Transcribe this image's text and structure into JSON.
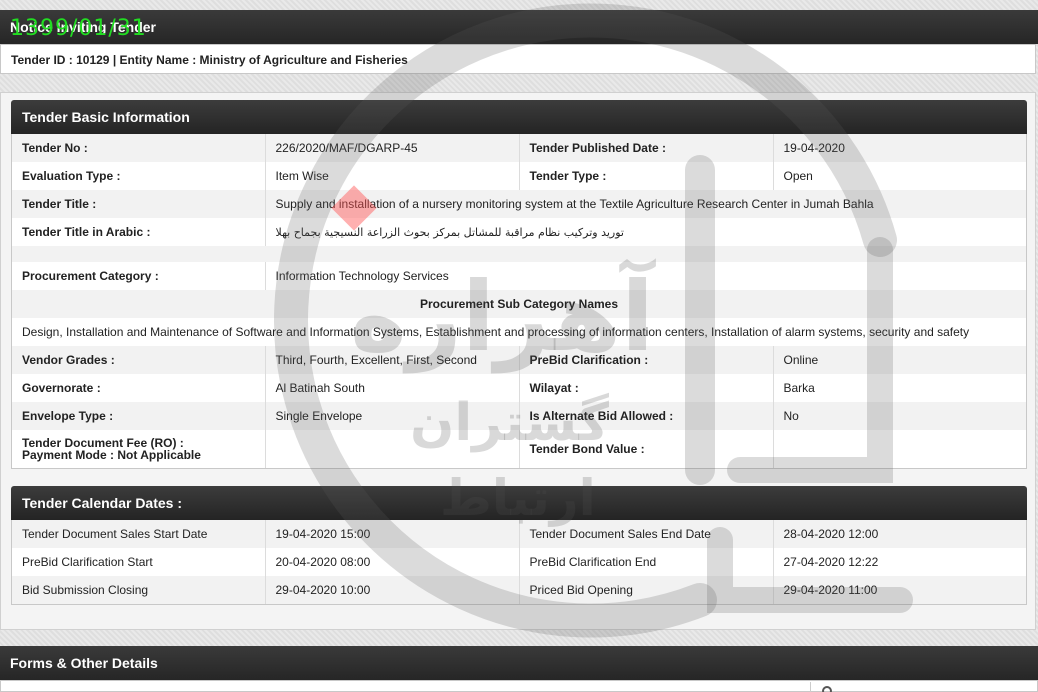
{
  "stamp": "1399/01/31",
  "header": {
    "title": "Notice Inviting Tender",
    "tender_line": "Tender ID : 10129 | Entity Name : Ministry of Agriculture and Fisheries"
  },
  "basic": {
    "title": "Tender Basic Information",
    "tender_no_label": "Tender No :",
    "tender_no": "226/2020/MAF/DGARP-45",
    "published_label": "Tender Published Date :",
    "published": "19-04-2020",
    "eval_label": "Evaluation Type :",
    "eval": "Item Wise",
    "type_label": "Tender Type :",
    "type": "Open",
    "title_label": "Tender Title :",
    "tender_title": "Supply and installation of a nursery monitoring system at the Textile Agriculture Research Center in Jumah Bahla",
    "arabic_label": "Tender Title in Arabic :",
    "arabic_title": "توريد وتركيب نظام مراقبة للمشاتل بمركز بحوث الزراعة النسيجية بجماح بهلا",
    "category_label": "Procurement Category :",
    "category": "Information Technology Services",
    "subcat_heading": "Procurement Sub Category Names",
    "subcat": "Design, Installation and Maintenance of Software and Information Systems, Establishment and processing of information centers, Installation of alarm systems, security and safety",
    "vendor_label": "Vendor Grades :",
    "vendor": "Third, Fourth, Excellent, First, Second",
    "prebid_label": "PreBid Clarification :",
    "prebid": "Online",
    "gov_label": "Governorate :",
    "gov": "Al Batinah South",
    "wilayat_label": "Wilayat :",
    "wilayat": "Barka",
    "envelope_label": "Envelope Type :",
    "envelope": "Single Envelope",
    "alternate_label": "Is Alternate Bid Allowed :",
    "alternate": "No",
    "fee_label": "Tender Document Fee (RO) :",
    "payment_label": "Payment Mode :  Not Applicable",
    "bond_label": "Tender Bond Value :"
  },
  "calendar": {
    "title": "Tender Calendar Dates :",
    "rows": [
      {
        "l1": "Tender Document Sales Start Date",
        "v1": "19-04-2020 15:00",
        "l2": "Tender Document Sales End Date",
        "v2": "28-04-2020 12:00"
      },
      {
        "l1": "PreBid Clarification Start",
        "v1": "20-04-2020 08:00",
        "l2": "PreBid Clarification End",
        "v2": "27-04-2020 12:22"
      },
      {
        "l1": "Bid Submission Closing",
        "v1": "29-04-2020 10:00",
        "l2": "Priced Bid Opening",
        "v2": "29-04-2020 11:00"
      }
    ]
  },
  "forms": {
    "title": "Forms & Other Details"
  },
  "watermark": {
    "text_1": "آهراره",
    "text_2": "گستران",
    "text_3": "ارتباط"
  }
}
